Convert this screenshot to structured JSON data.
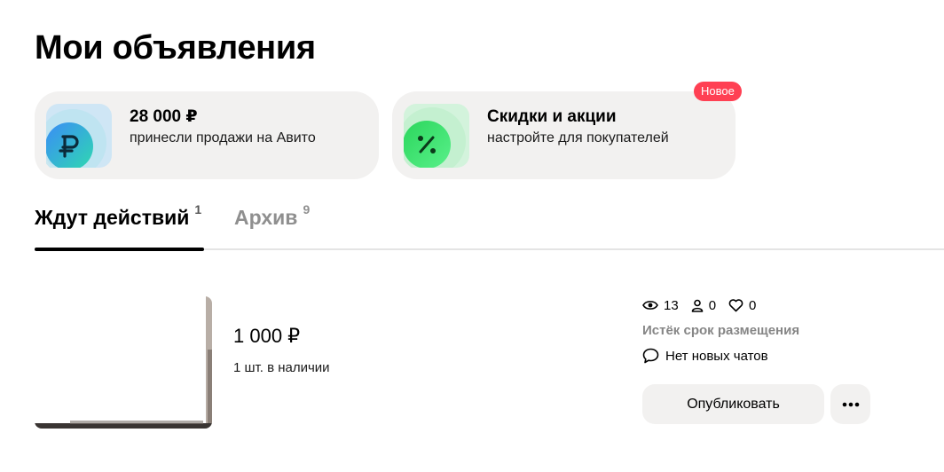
{
  "page": {
    "title": "Мои объявления"
  },
  "promos": {
    "sales": {
      "icon": "ruble-icon",
      "title": "28 000 ₽",
      "subtitle": "принесли продажи на Авито"
    },
    "discounts": {
      "icon": "percent-icon",
      "title": "Скидки и акции",
      "subtitle": "настройте для покупателей",
      "badge": "Новое"
    }
  },
  "tabs": [
    {
      "label": "Ждут действий",
      "count": "1",
      "active": true
    },
    {
      "label": "Архив",
      "count": "9",
      "active": false
    }
  ],
  "listing": {
    "price": "1 000 ₽",
    "stock": "1 шт. в наличии",
    "stats": {
      "views": "13",
      "contacts": "0",
      "favorites": "0"
    },
    "status": "Истёк срок размещения",
    "chats": "Нет новых чатов",
    "publish_label": "Опубликовать",
    "more_label": "•••"
  },
  "colors": {
    "accent_badge": "#ff4053",
    "card_bg": "#f2f1f0",
    "muted_text": "#868686",
    "ruble_icon_bg": "#4aa3f5",
    "percent_icon_bg": "#2ee06a"
  }
}
